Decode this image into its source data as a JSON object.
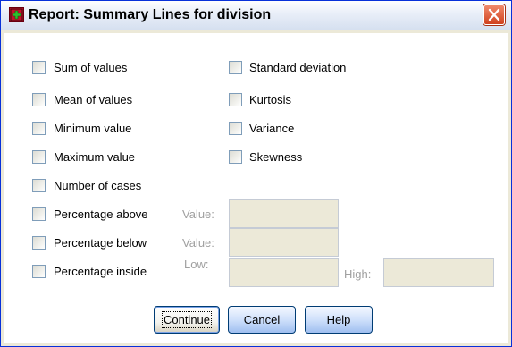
{
  "window": {
    "title": "Report: Summary Lines for division",
    "close_icon": "close-icon",
    "app_icon": "spss-dialog-icon",
    "colors": {
      "titlebar_border": "#0831d9",
      "close_red": "#d0421f",
      "app_icon_red": "#c8102e"
    }
  },
  "checkboxes_left": [
    {
      "label": "Sum of values",
      "checked": false
    },
    {
      "label": "Mean of values",
      "checked": false
    },
    {
      "label": "Minimum value",
      "checked": false
    },
    {
      "label": "Maximum value",
      "checked": false
    },
    {
      "label": "Number of cases",
      "checked": false
    },
    {
      "label": "Percentage above",
      "checked": false
    },
    {
      "label": "Percentage below",
      "checked": false
    },
    {
      "label": "Percentage inside",
      "checked": false
    }
  ],
  "checkboxes_right": [
    {
      "label": "Standard deviation",
      "checked": false
    },
    {
      "label": "Kurtosis",
      "checked": false
    },
    {
      "label": "Variance",
      "checked": false
    },
    {
      "label": "Skewness",
      "checked": false
    }
  ],
  "fields": {
    "above_value_label": "Value:",
    "above_value": "",
    "below_value_label": "Value:",
    "below_value": "",
    "inside_low_label": "Low:",
    "inside_low": "",
    "inside_high_label": "High:",
    "inside_high": ""
  },
  "buttons": {
    "continue": "Continue",
    "cancel": "Cancel",
    "help": "Help"
  }
}
